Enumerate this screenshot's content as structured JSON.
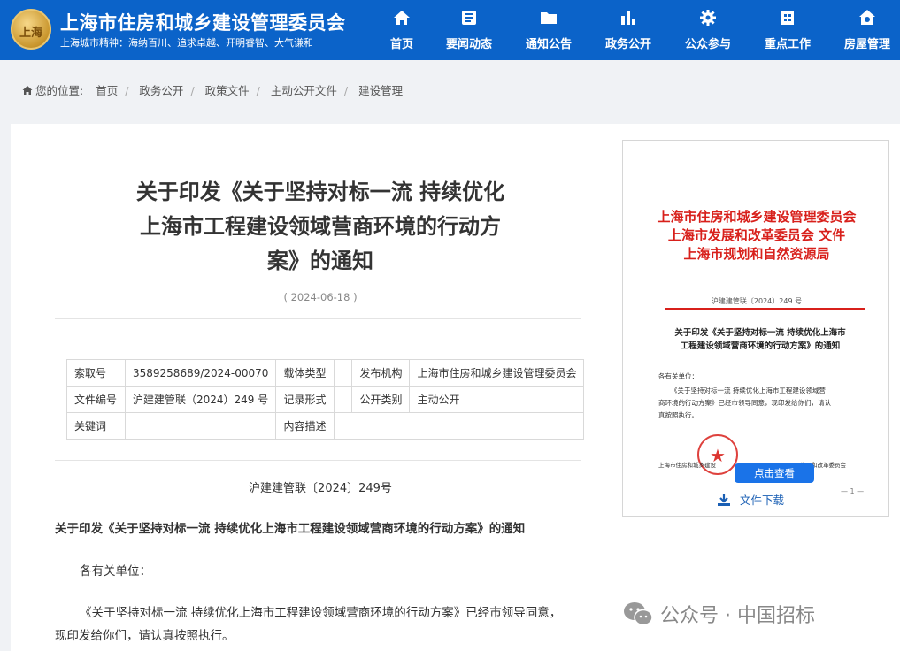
{
  "site": {
    "title": "上海市住房和城乡建设管理委员会",
    "slogan": "上海城市精神：海纳百川、追求卓越、开明睿智、大气谦和",
    "logo_text": "上海"
  },
  "nav": [
    {
      "label": "首页",
      "icon": "home-icon"
    },
    {
      "label": "要闻动态",
      "icon": "news-icon"
    },
    {
      "label": "通知公告",
      "icon": "folder-icon"
    },
    {
      "label": "政务公开",
      "icon": "chart-icon"
    },
    {
      "label": "公众参与",
      "icon": "gear-icon"
    },
    {
      "label": "重点工作",
      "icon": "building-icon"
    },
    {
      "label": "房屋管理",
      "icon": "house-icon"
    }
  ],
  "breadcrumb": {
    "prefix": "您的位置:",
    "items": [
      "首页",
      "政务公开",
      "政策文件",
      "主动公开文件",
      "建设管理"
    ]
  },
  "article": {
    "title_lines": [
      "关于印发《关于坚持对标一流 持续优化",
      "上海市工程建设领域营商环境的行动方",
      "案》的通知"
    ],
    "date": "( 2024-06-18 )",
    "meta": {
      "index_no_label": "索取号",
      "index_no": "3589258689/2024-00070",
      "carrier_label": "载体类型",
      "carrier": "",
      "issuer_label": "发布机构",
      "issuer": "上海市住房和城乡建设管理委员会",
      "doc_no_label": "文件编号",
      "doc_no": "沪建建管联（2024）249 号",
      "record_label": "记录形式",
      "record": "",
      "category_label": "公开类别",
      "category": "主动公开",
      "keywords_label": "关键词",
      "keywords": "",
      "desc_label": "内容描述",
      "desc": ""
    },
    "doc_number": "沪建建管联〔2024〕249号",
    "heading": "关于印发《关于坚持对标一流  持续优化上海市工程建设领域营商环境的行动方案》的通知",
    "salutation": "各有关单位：",
    "para1_line1": "《关于坚持对标一流  持续优化上海市工程建设领域营商环境的行动方案》已经市领导同意，",
    "para1_line2": "现印发给你们，请认真按照执行。"
  },
  "preview": {
    "red_head_lines": [
      "上海市住房和城乡建设管理委员会",
      "上海市发展和改革委员会   文件",
      "上海市规划和自然资源局"
    ],
    "doc_no": "沪建建管联〔2024〕249 号",
    "title_lines": [
      "关于印发《关于坚持对标一流  持续优化上海市",
      "工程建设领域营商环境的行动方案》的通知"
    ],
    "salutation": "各有关单位：",
    "body_lines": [
      "《关于坚持对标一流  持续优化上海市工程建设领域营",
      "商环境的行动方案》已经市领导同意，现印发给你们，请认",
      "真按照执行。"
    ],
    "signature_left": "上海市住房和城乡建设",
    "signature_right": "发展和改革委员会",
    "page_mark": "— 1 —",
    "view_button": "点击查看",
    "download_label": "文件下载"
  },
  "watermark": {
    "text": "公众号 · 中国招标"
  },
  "colors": {
    "header_blue": "#0b63c9",
    "seal_red": "#d8201b",
    "button_blue": "#1a73e8"
  }
}
